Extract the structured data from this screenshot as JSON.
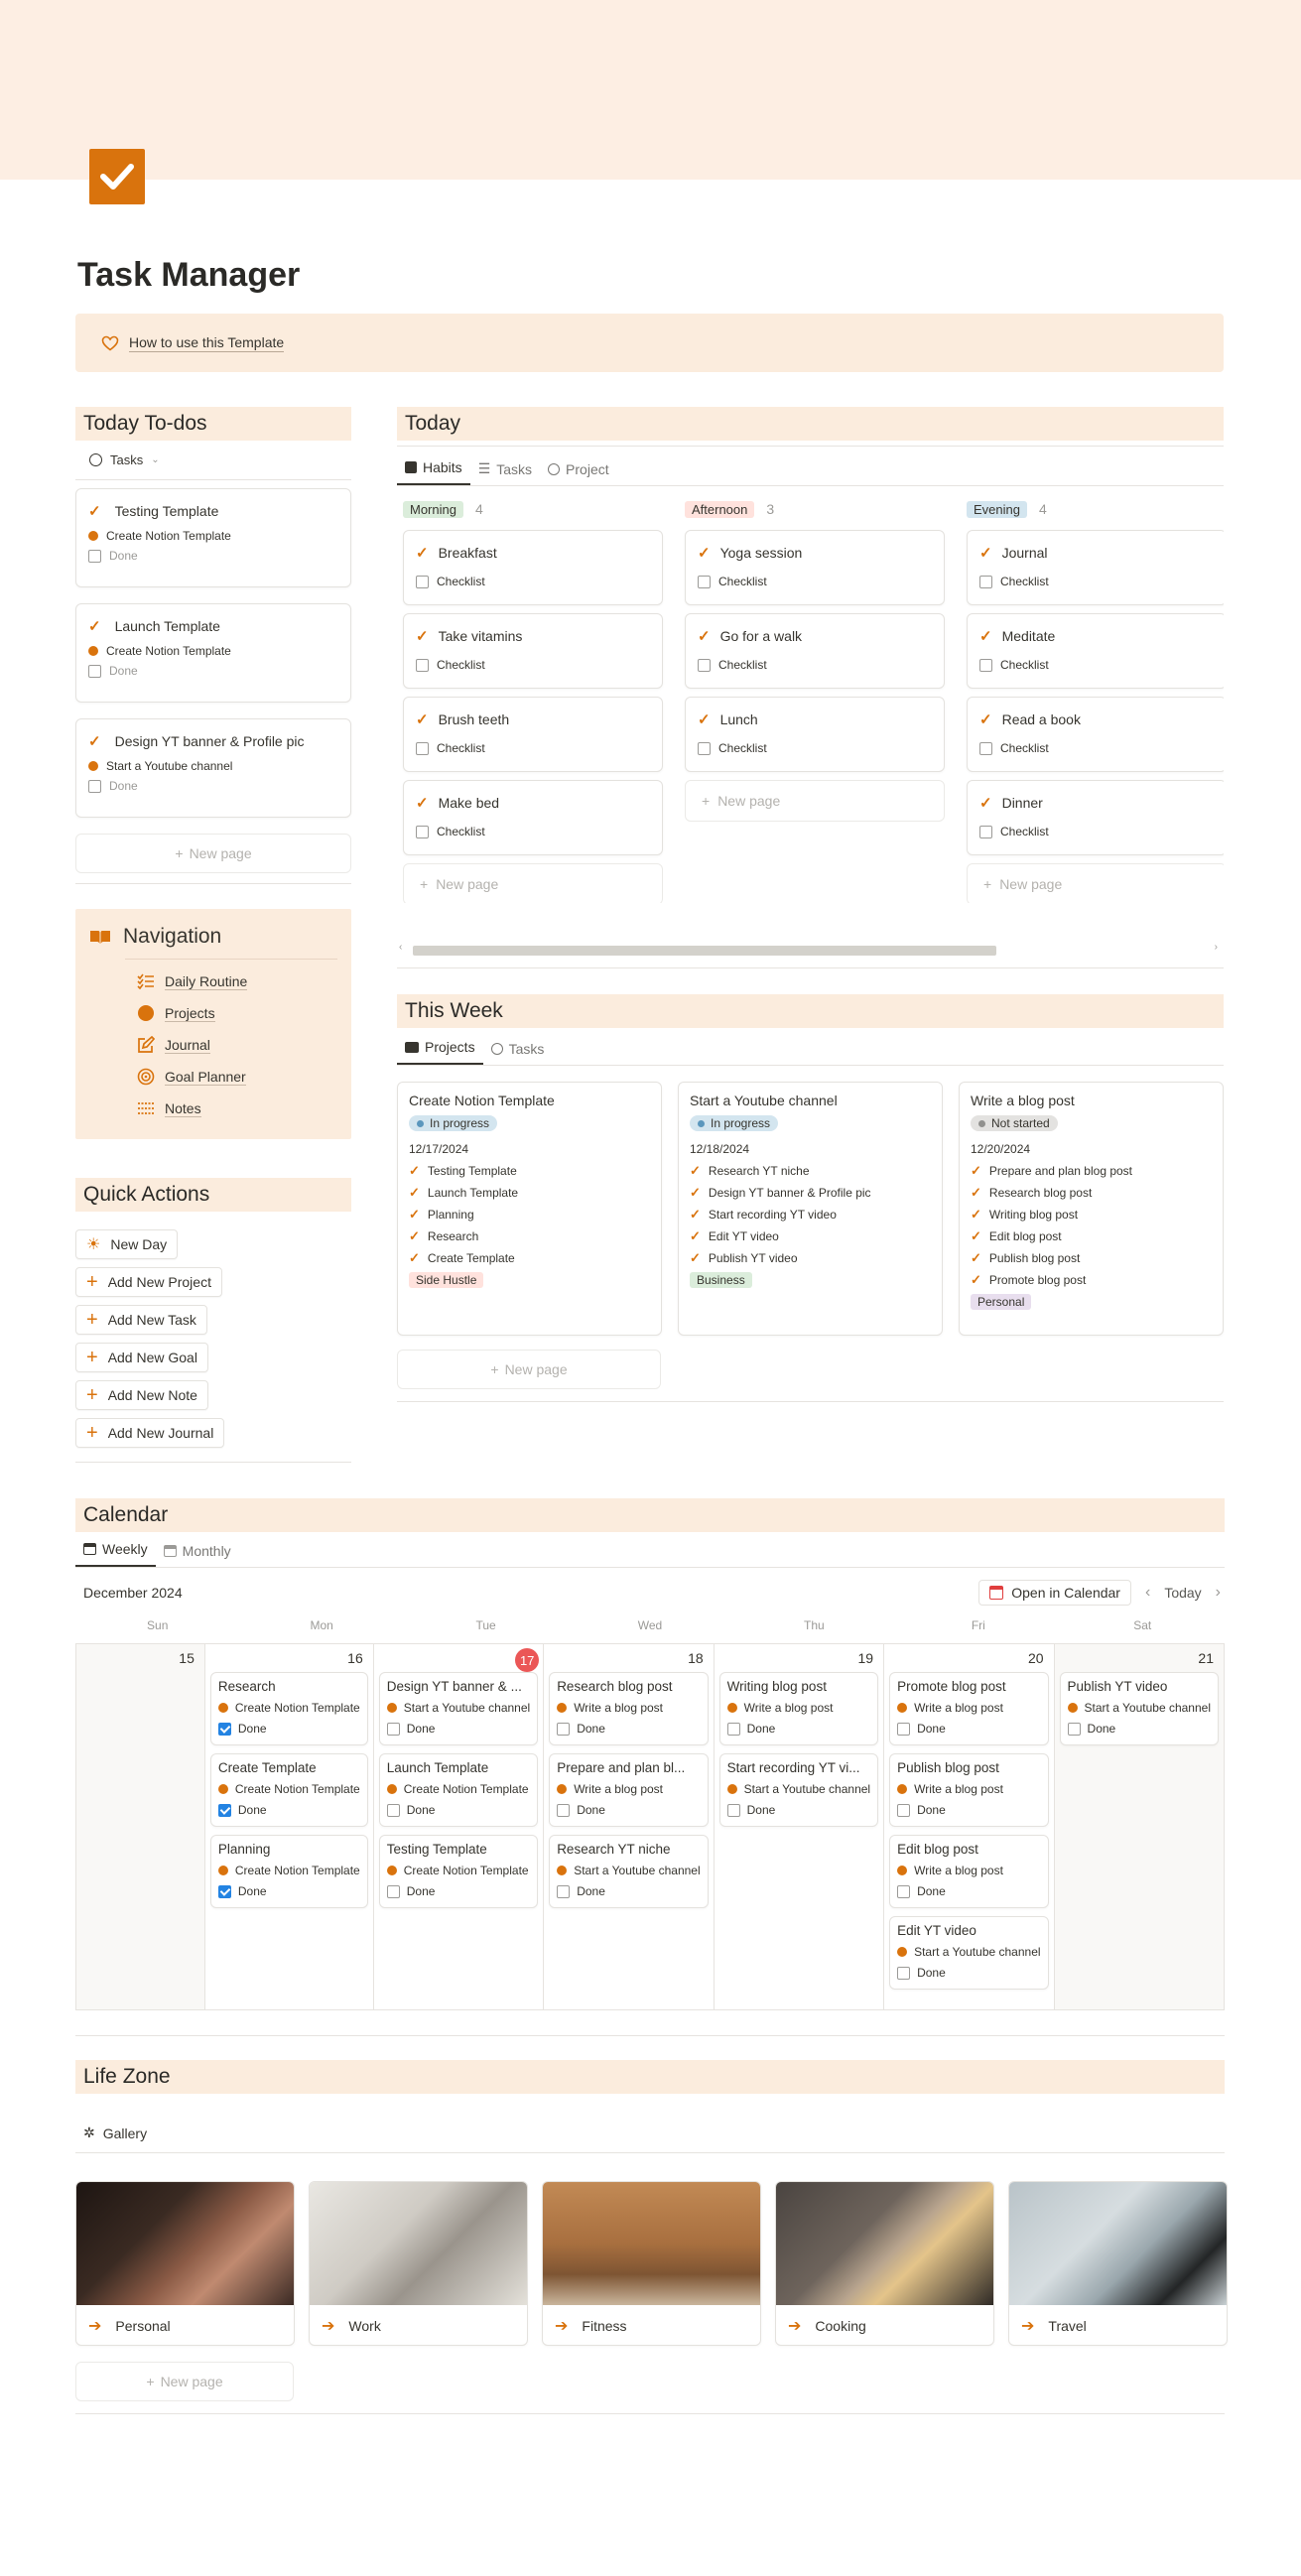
{
  "page": {
    "title": "Task Manager",
    "callout_link": "How to use this Template"
  },
  "today_todos": {
    "title": "Today To-dos",
    "view": "Tasks",
    "items": [
      {
        "title": "Testing  Template",
        "project": "Create Notion Template",
        "done": "Done"
      },
      {
        "title": "Launch Template",
        "project": "Create Notion Template",
        "done": "Done"
      },
      {
        "title": "Design YT banner & Profile pic",
        "project": "Start a Youtube channel",
        "done": "Done"
      }
    ],
    "new_page": "New page"
  },
  "navigation": {
    "title": "Navigation",
    "items": [
      {
        "label": "Daily Routine",
        "icon": "checklist-icon"
      },
      {
        "label": "Projects",
        "icon": "circle-icon"
      },
      {
        "label": "Journal",
        "icon": "pencil-square-icon"
      },
      {
        "label": "Goal Planner",
        "icon": "target-icon"
      },
      {
        "label": "Notes",
        "icon": "notes-icon"
      }
    ]
  },
  "quick_actions": {
    "title": "Quick Actions",
    "items": [
      "New Day",
      "Add New Project",
      "Add New Task",
      "Add New Goal",
      "Add New Note",
      "Add New Journal"
    ]
  },
  "today": {
    "title": "Today",
    "tabs": [
      "Habits",
      "Tasks",
      "Project"
    ],
    "columns": [
      {
        "name": "Morning",
        "count": "4",
        "color": "#dbeddb",
        "items": [
          "Breakfast",
          "Take vitamins",
          "Brush teeth",
          "Make bed"
        ]
      },
      {
        "name": "Afternoon",
        "count": "3",
        "color": "#ffe2dd",
        "items": [
          "Yoga session",
          "Go for a walk",
          "Lunch"
        ]
      },
      {
        "name": "Evening",
        "count": "4",
        "color": "#d3e5ef",
        "items": [
          "Journal",
          "Meditate",
          "Read a book",
          "Dinner"
        ]
      }
    ],
    "checklist": "Checklist",
    "new_page": "New page"
  },
  "this_week": {
    "title": "This Week",
    "tabs": [
      "Projects",
      "Tasks"
    ],
    "projects": [
      {
        "title": "Create Notion Template",
        "status": "In progress",
        "date": "12/17/2024",
        "tasks": [
          "Testing Template",
          "Launch Template",
          "Planning",
          "Research",
          "Create Template"
        ],
        "tag": "Side Hustle"
      },
      {
        "title": "Start a Youtube channel",
        "status": "In progress",
        "date": "12/18/2024",
        "tasks": [
          "Research YT niche",
          "Design YT banner & Profile pic",
          "Start recording YT video",
          "Edit YT video",
          "Publish YT video"
        ],
        "tag": "Business"
      },
      {
        "title": "Write a blog post",
        "status": "Not started",
        "date": "12/20/2024",
        "tasks": [
          "Prepare and plan blog post",
          "Research blog post",
          "Writing blog post",
          "Edit blog post",
          "Publish blog post",
          "Promote blog post"
        ],
        "tag": "Personal"
      }
    ],
    "new_page": "New page"
  },
  "calendar": {
    "title": "Calendar",
    "tabs": [
      "Weekly",
      "Monthly"
    ],
    "month": "December 2024",
    "open_btn": "Open in Calendar",
    "today_btn": "Today",
    "weekdays": [
      "Sun",
      "Mon",
      "Tue",
      "Wed",
      "Thu",
      "Fri",
      "Sat"
    ],
    "days": [
      {
        "num": "15",
        "events": []
      },
      {
        "num": "16",
        "events": [
          {
            "title": "Research",
            "project": "Create Notion Template",
            "done": true
          },
          {
            "title": "Create Template",
            "project": "Create Notion Template",
            "done": true
          },
          {
            "title": "Planning",
            "project": "Create Notion Template",
            "done": true
          }
        ]
      },
      {
        "num": "17",
        "today": true,
        "events": [
          {
            "title": "Design YT banner & ...",
            "project": "Start a Youtube channel",
            "done": false
          },
          {
            "title": "Launch Template",
            "project": "Create Notion Template",
            "done": false
          },
          {
            "title": "Testing Template",
            "project": "Create Notion Template",
            "done": false
          }
        ]
      },
      {
        "num": "18",
        "events": [
          {
            "title": "Research blog post",
            "project": "Write a blog post",
            "done": false
          },
          {
            "title": "Prepare and plan bl...",
            "project": "Write a blog post",
            "done": false
          },
          {
            "title": "Research YT niche",
            "project": "Start a Youtube channel",
            "done": false
          }
        ]
      },
      {
        "num": "19",
        "events": [
          {
            "title": "Writing blog post",
            "project": "Write a blog post",
            "done": false
          },
          {
            "title": "Start recording YT vi...",
            "project": "Start a Youtube channel",
            "done": false
          }
        ]
      },
      {
        "num": "20",
        "events": [
          {
            "title": "Promote blog post",
            "project": "Write a blog post",
            "done": false
          },
          {
            "title": "Publish blog post",
            "project": "Write a blog post",
            "done": false
          },
          {
            "title": "Edit blog post",
            "project": "Write a blog post",
            "done": false
          },
          {
            "title": "Edit YT video",
            "project": "Start a Youtube channel",
            "done": false
          }
        ]
      },
      {
        "num": "21",
        "events": [
          {
            "title": "Publish YT video",
            "project": "Start a Youtube channel",
            "done": false
          }
        ]
      }
    ],
    "done_label": "Done"
  },
  "life_zone": {
    "title": "Life Zone",
    "view": "Gallery",
    "items": [
      "Personal",
      "Work",
      "Fitness",
      "Cooking",
      "Travel"
    ],
    "new_page": "New page"
  }
}
